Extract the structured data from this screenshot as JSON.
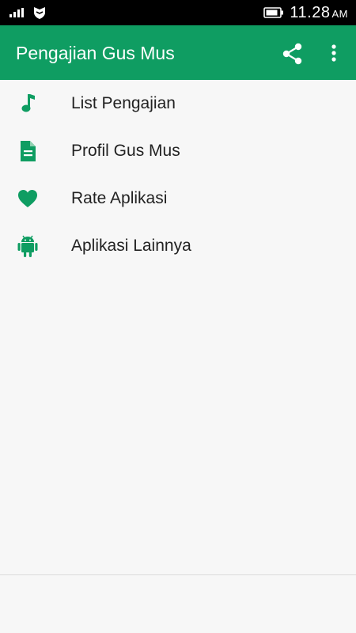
{
  "status_bar": {
    "time": "11.28",
    "ampm": "AM",
    "icons": [
      "signal-icon",
      "shield-icon",
      "battery-icon"
    ]
  },
  "app_bar": {
    "title": "Pengajian Gus Mus",
    "actions": [
      "share-icon",
      "more-vert-icon"
    ],
    "color": "#0f9d62"
  },
  "menu": {
    "items": [
      {
        "label": "List Pengajian",
        "icon": "music-note-icon"
      },
      {
        "label": "Profil Gus Mus",
        "icon": "document-icon"
      },
      {
        "label": "Rate Aplikasi",
        "icon": "heart-icon"
      },
      {
        "label": "Aplikasi Lainnya",
        "icon": "android-icon"
      }
    ],
    "icon_color": "#0f9d62"
  }
}
